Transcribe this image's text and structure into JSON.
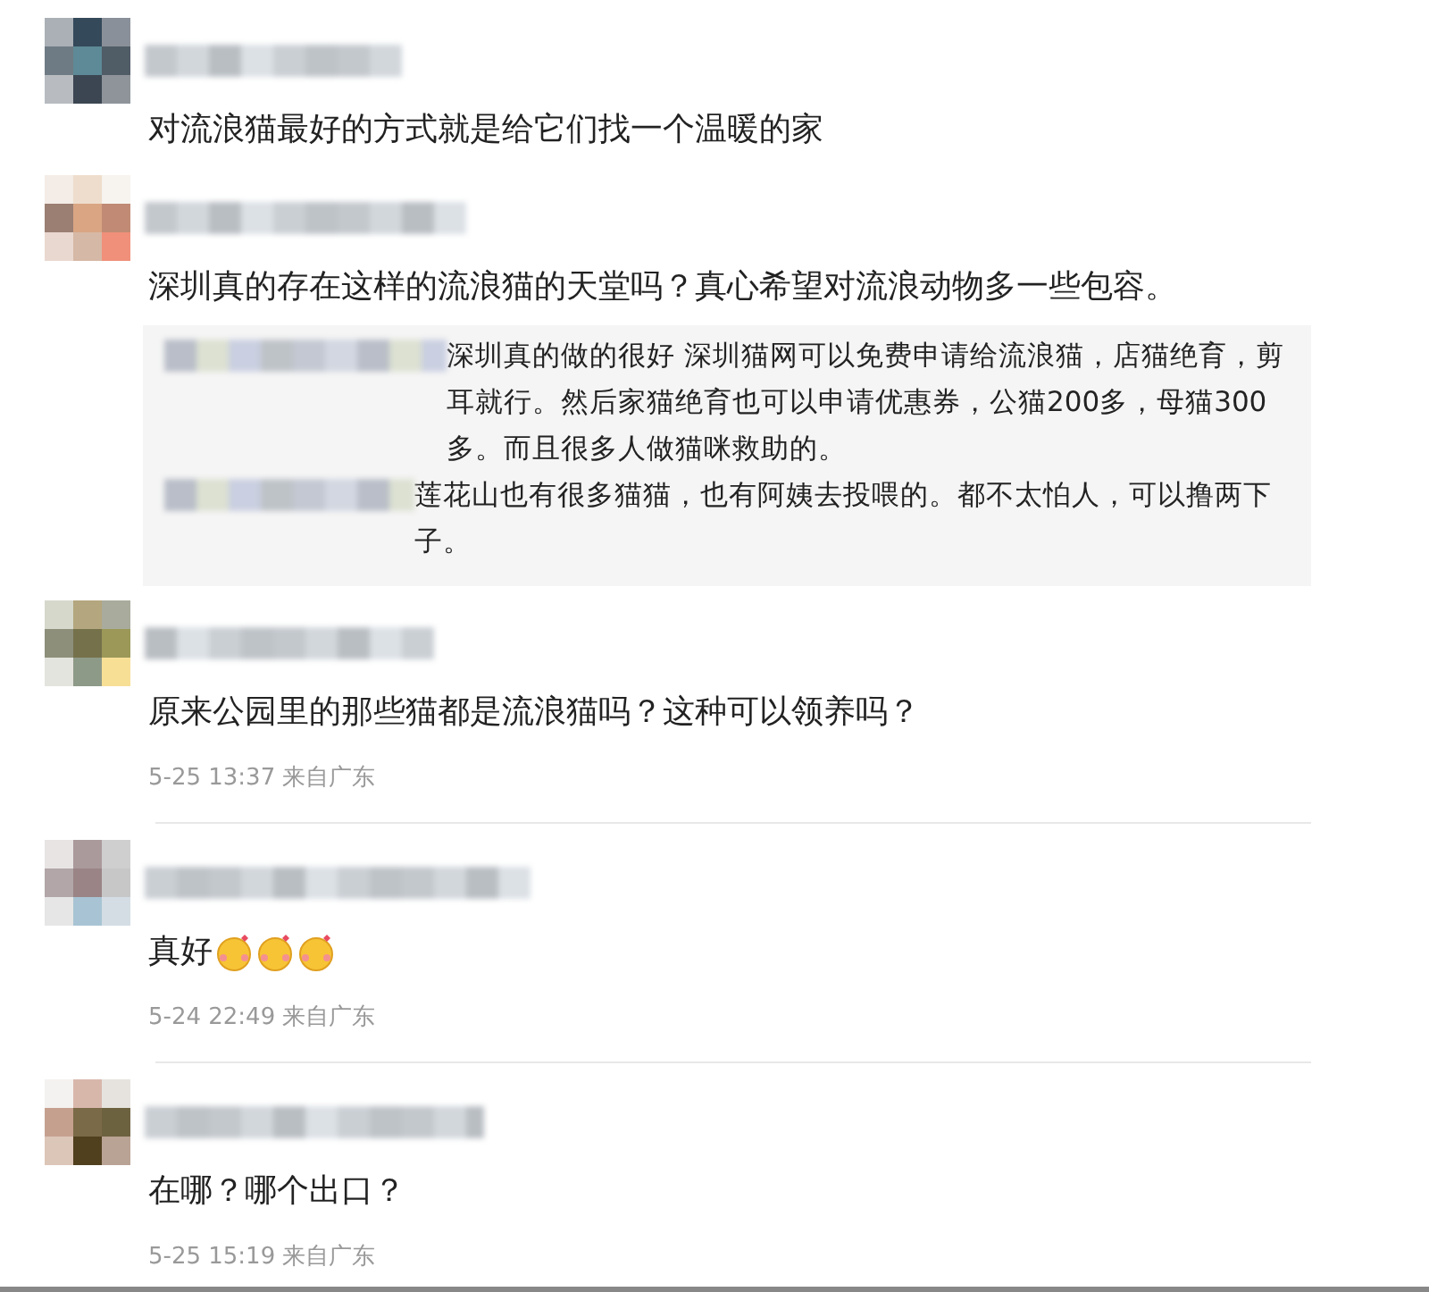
{
  "comments": [
    {
      "text": "对流浪猫最好的方式就是给它们找一个温暖的家"
    },
    {
      "text": "深圳真的存在这样的流浪猫的天堂吗？真心希望对流浪动物多一些包容。",
      "replies": [
        {
          "text": "深圳真的做的很好 深圳猫网可以免费申请给流浪猫，店猫绝育，剪耳就行。然后家猫绝育也可以申请优惠券，公猫200多，母猫300多。而且很多人做猫咪救助的。"
        },
        {
          "text": "莲花山也有很多猫猫，也有阿姨去投喂的。都不太怕人，可以撸两下子。"
        }
      ]
    },
    {
      "text": "原来公园里的那些猫都是流浪猫吗？这种可以领养吗？",
      "meta": "5-25 13:37 来自广东"
    },
    {
      "text": "真好",
      "emojis": [
        {
          "kind": "emoji"
        },
        {
          "kind": "emoji"
        },
        {
          "kind": "emoji"
        }
      ],
      "meta": "5-24 22:49 来自广东"
    },
    {
      "text": "在哪？哪个出口？",
      "meta": "5-25 15:19 来自广东"
    }
  ]
}
